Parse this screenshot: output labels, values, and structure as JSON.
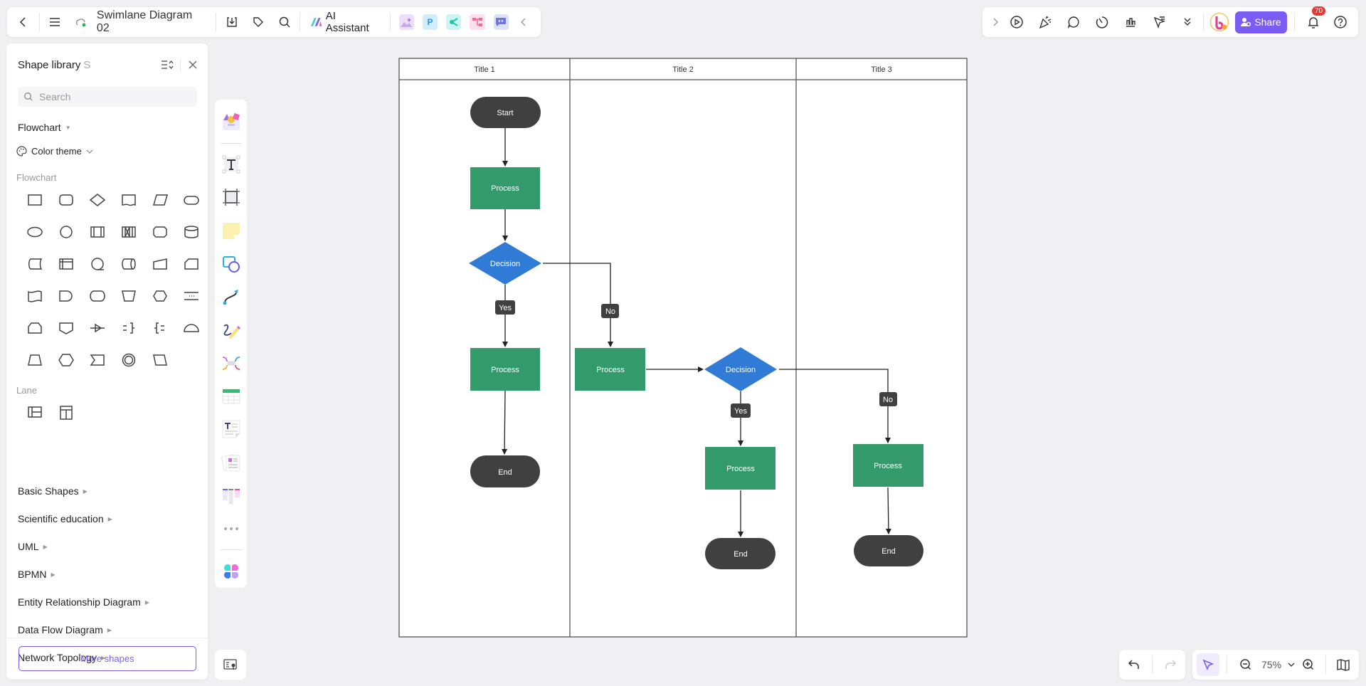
{
  "top_left_toolbar": {
    "doc_title": "Swimlane Diagram 02",
    "ai_label": "AI Assistant",
    "apps": [
      "image-generator",
      "p-app",
      "mindmap-app",
      "tree-app",
      "chat-app"
    ]
  },
  "top_right_toolbar": {
    "share_label": "Share",
    "notification_count": "70"
  },
  "shape_library": {
    "title": "Shape library",
    "shortcut": "S",
    "search_placeholder": "Search",
    "category": "Flowchart",
    "color_theme_label": "Color theme",
    "flowchart_heading": "Flowchart",
    "flowchart_shapes": [
      "process",
      "rounded-rectangle",
      "decision",
      "document",
      "data",
      "terminator",
      "ellipse",
      "circle",
      "predefined-process",
      "subprocess-x",
      "alternate-process",
      "database",
      "stored-data",
      "internal-storage",
      "sequential-data",
      "direct-data",
      "manual-input",
      "card",
      "punched-tape",
      "delay",
      "display-rounded",
      "manual-operation",
      "preparation",
      "divider",
      "loop-limit",
      "off-page-connector",
      "merge-arrow",
      "annotation-right",
      "annotation-left",
      "half-circle",
      "trapezoid",
      "hexagon",
      "step",
      "double-circle",
      "parallelogram"
    ],
    "lane_heading": "Lane",
    "lane_shapes": [
      "horizontal-lane",
      "vertical-lane"
    ],
    "sections": [
      "Basic Shapes",
      "Scientific education",
      "UML",
      "BPMN",
      "Entity Relationship Diagram",
      "Data Flow Diagram",
      "Network Topology"
    ],
    "more_shapes_label": "More shapes"
  },
  "zoom_controls": {
    "zoom_level": "75%"
  },
  "diagram": {
    "lanes": [
      "Title 1",
      "Title 2",
      "Title 3"
    ],
    "nodes": {
      "start": "Start",
      "process_a": "Process",
      "decision_a": "Decision",
      "process_b": "Process",
      "end_a": "End",
      "process_c": "Process",
      "decision_b": "Decision",
      "process_d": "Process",
      "end_b": "End",
      "process_e": "Process",
      "end_c": "End"
    },
    "labels": {
      "yes_a": "Yes",
      "no_a": "No",
      "yes_b": "Yes",
      "no_b": "No"
    },
    "colors": {
      "terminator": "#404040",
      "process": "#339a6c",
      "decision": "#2f7bd6",
      "brand": "#7a5cf5"
    }
  }
}
